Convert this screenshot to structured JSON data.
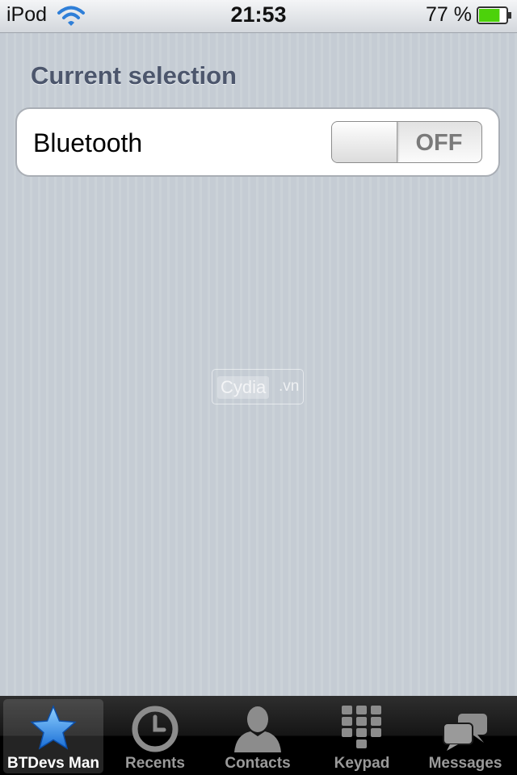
{
  "status_bar": {
    "device": "iPod",
    "time": "21:53",
    "battery_percent": "77 %",
    "battery_level": 0.77,
    "wifi_icon": "wifi-icon",
    "battery_icon": "battery-icon"
  },
  "section": {
    "title": "Current selection"
  },
  "settings": {
    "bluetooth": {
      "label": "Bluetooth",
      "toggle_text": "OFF",
      "state": "off"
    }
  },
  "watermark": {
    "main": "Cydia",
    "tld": ".vn"
  },
  "tab_bar": {
    "selected": 0,
    "tabs": [
      {
        "label": "BTDevs Man",
        "icon": "star-icon"
      },
      {
        "label": "Recents",
        "icon": "clock-icon"
      },
      {
        "label": "Contacts",
        "icon": "person-icon"
      },
      {
        "label": "Keypad",
        "icon": "keypad-icon"
      },
      {
        "label": "Messages",
        "icon": "speech-bubbles-icon"
      }
    ]
  },
  "colors": {
    "section_title": "#4c566c",
    "battery_fill": "#4cd20a",
    "star_blue": "#3a8ee6",
    "tab_inactive": "#9a9a9a"
  }
}
